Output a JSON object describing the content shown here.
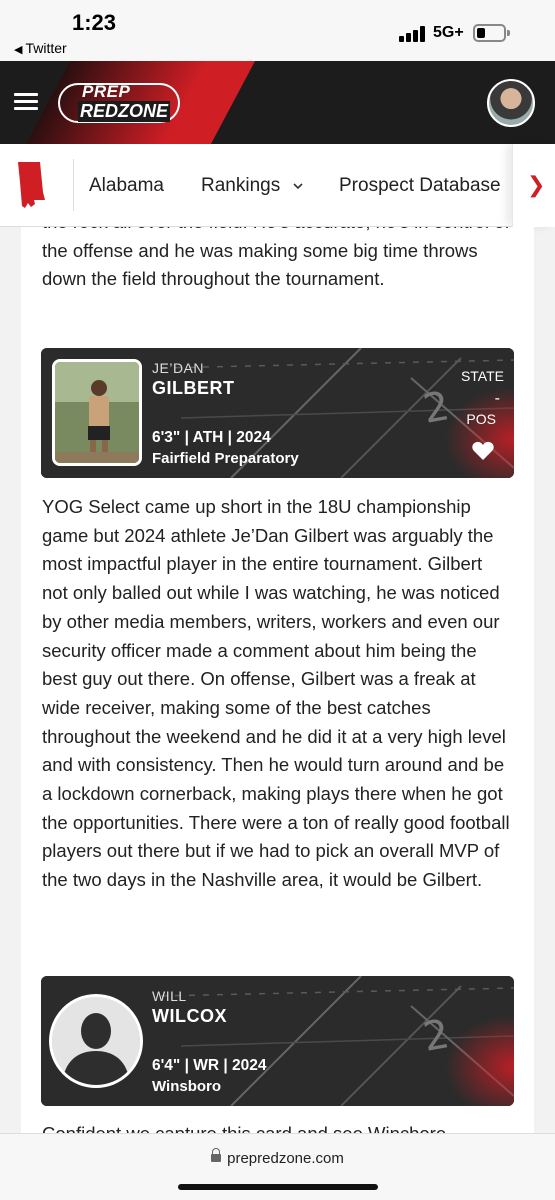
{
  "status_bar": {
    "time": "1:23",
    "back_app": "Twitter",
    "network": "5G+",
    "battery_level": 0.3
  },
  "header": {
    "logo_top": "PREP",
    "logo_bottom": "REDZONE",
    "brand_color": "#d01e25",
    "menu_icon": "hamburger-menu-icon",
    "avatar_icon": "user-avatar"
  },
  "nav": {
    "state_icon": "alabama-state-icon",
    "items": [
      {
        "label": "Alabama"
      },
      {
        "label": "Rankings",
        "icon": "chevron-down-icon"
      },
      {
        "label": "Prospect Database"
      }
    ],
    "next_icon": "chevron-right-icon"
  },
  "article": {
    "para_top": "the rock all over the field. He's accurate, he's in control of the offense and he was making some big time throws down the field throughout the tournament.",
    "para_mid": "YOG Select came up short in the 18U championship game but 2024 athlete Je’Dan Gilbert was arguably the most impactful player in the entire tournament. Gilbert not only balled out while I was watching, he was noticed by other media members, writers, workers and even our security officer made a comment about him being the best guy out there. On offense, Gilbert was a freak at wide receiver, making some of the best catches throughout the weekend and he did it at a very high level and with consistency. Then he would turn around and be a lockdown cornerback, making plays there when he got the opportunities. There were a ton of really good football players out there but if we had to pick an overall MVP of the two days in the Nashville area, it would be Gilbert.",
    "para_bottom": "Confident we capture this card and see Wincbore..."
  },
  "players": [
    {
      "first": "JE’DAN",
      "last": "GILBERT",
      "meta": "6'3\" | ATH | 2024",
      "school": "Fairfield Preparatory",
      "state_label": "STATE",
      "state_value": "-",
      "pos_label": "POS",
      "favorite_icon": "heart-icon"
    },
    {
      "first": "WILL",
      "last": "WILCOX",
      "meta": "6'4\" | WR | 2024",
      "school": "Winsboro"
    }
  ],
  "browser": {
    "url": "prepredzone.com",
    "lock_icon": "lock-icon"
  }
}
